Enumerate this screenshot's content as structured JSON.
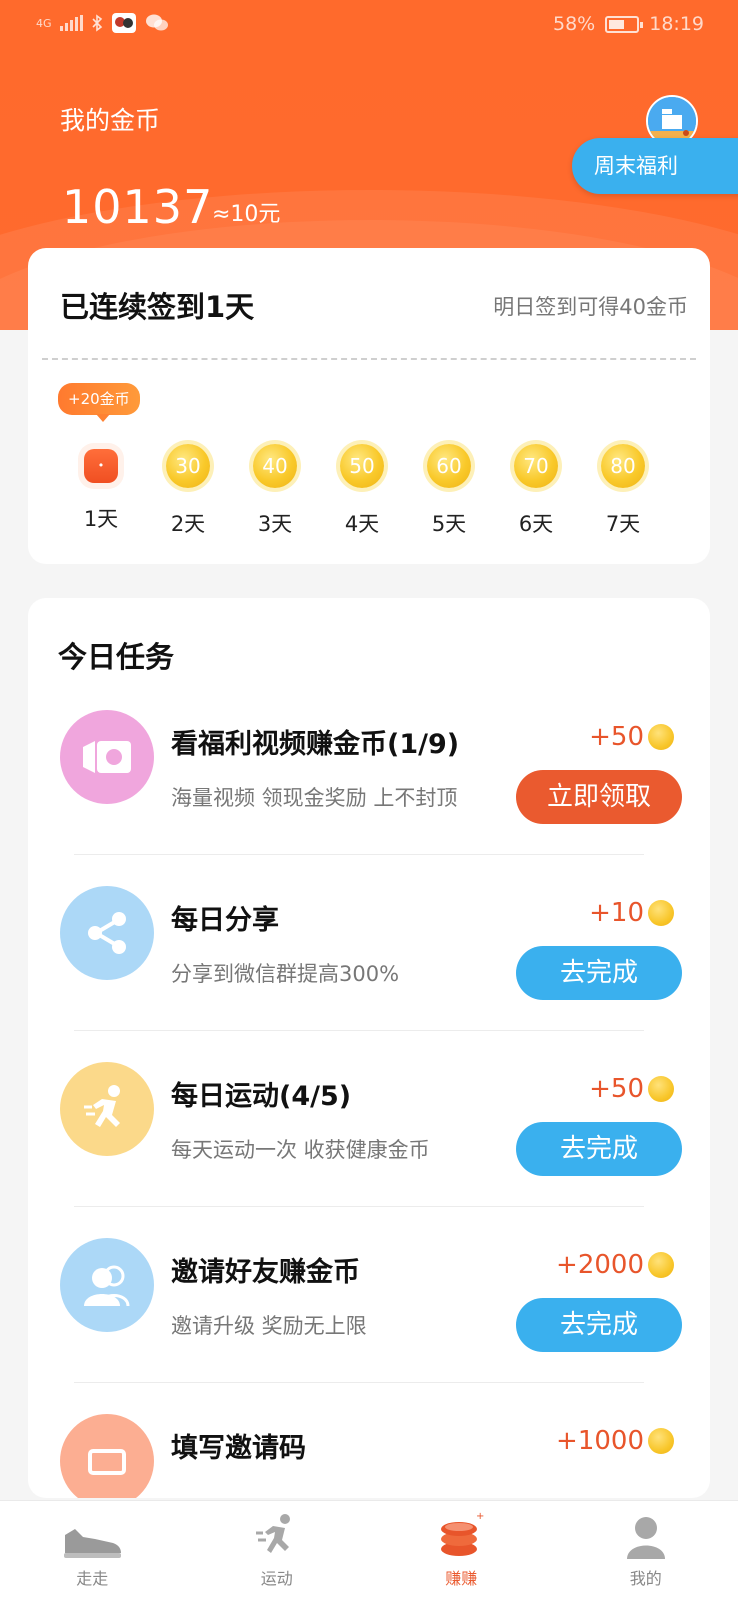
{
  "status_bar": {
    "network": "4G",
    "battery": "58%",
    "battery_level": 0.58,
    "time": "18:19"
  },
  "header": {
    "title": "我的金币",
    "coins": "10137",
    "approx": "≈10元",
    "weekend_button": "周末福利"
  },
  "checkin": {
    "title": "已连续签到1天",
    "tip": "明日签到可得40金币",
    "bonus_tag": "+20金币",
    "days": [
      {
        "coin": "",
        "label": "1天",
        "done": true
      },
      {
        "coin": "30",
        "label": "2天",
        "done": false
      },
      {
        "coin": "40",
        "label": "3天",
        "done": false
      },
      {
        "coin": "50",
        "label": "4天",
        "done": false
      },
      {
        "coin": "60",
        "label": "5天",
        "done": false
      },
      {
        "coin": "70",
        "label": "6天",
        "done": false
      },
      {
        "coin": "80",
        "label": "7天",
        "done": false
      }
    ]
  },
  "tasks": {
    "heading": "今日任务",
    "items": [
      {
        "name": "看福利视频赚金币(1/9)",
        "desc": "海量视频 领现金奖励 上不封顶",
        "reward": "+50",
        "button": "立即领取",
        "icon": "video-icon",
        "icon_color": "#f0a0dc"
      },
      {
        "name": "每日分享",
        "desc": "分享到微信群提高300%",
        "reward": "+10",
        "button": "去完成",
        "icon": "share-icon",
        "icon_color": "#a8d6f7"
      },
      {
        "name": "每日运动(4/5)",
        "desc": "每天运动一次 收获健康金币",
        "reward": "+50",
        "button": "去完成",
        "icon": "running-icon",
        "icon_color": "#fbd77e"
      },
      {
        "name": "邀请好友赚金币",
        "desc": "邀请升级 奖励无上限",
        "reward": "+2000",
        "button": "去完成",
        "icon": "friends-icon",
        "icon_color": "#a8d6f7"
      },
      {
        "name": "填写邀请码",
        "desc": "",
        "reward": "+1000",
        "button": "",
        "icon": "invite-code-icon",
        "icon_color": "#fba98c"
      }
    ]
  },
  "nav": {
    "items": [
      {
        "label": "走走",
        "icon": "shoe-icon"
      },
      {
        "label": "运动",
        "icon": "run-icon"
      },
      {
        "label": "赚赚",
        "icon": "coins-icon"
      },
      {
        "label": "我的",
        "icon": "user-icon"
      }
    ],
    "active": "赚赚"
  },
  "colors": {
    "brand_orange": "#ff6a2c",
    "accent_blue": "#3ab0ee",
    "reward_red": "#e8552b"
  }
}
